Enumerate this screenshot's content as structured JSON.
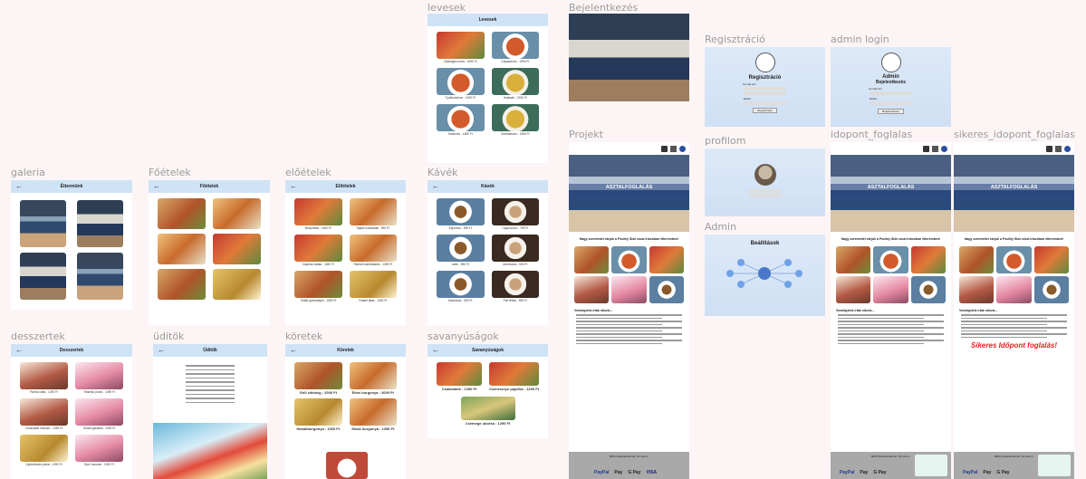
{
  "labels": {
    "levesek": "levesek",
    "bejelentkezes": "Bejelentkezés",
    "regisztracio": "Regisztráció",
    "admin_login": "admin login",
    "galeria": "galeria",
    "foetelek": "Főételek",
    "eloetelek": "előételek",
    "kavek": "Kávék",
    "projekt": "Projekt",
    "profilom": "profilom",
    "idopont_foglalas": "idopont_foglalas",
    "sikeres_idopont_foglalas": "sikeres_idopont_foglalas",
    "admin": "Admin",
    "desszertek": "desszertek",
    "uditok": "üditök",
    "koretek": "köretek",
    "savanyusagok": "savanyúságok"
  },
  "headers": {
    "levesek": "Levesek",
    "galeria": "Éttermünk",
    "foetelek": "Főételek",
    "eloetelek": "Előételek",
    "kavek": "Kávék",
    "desszertek": "Desszertek",
    "uditok": "Üdítők",
    "koretek": "Köretek",
    "savanyusagok": "Savanyúságok"
  },
  "levesek_items": [
    "Zöldséges leves - 1690 Ft",
    "Gulyásleves - 1990 Ft",
    "Tyúkhúsleves - 1490 Ft",
    "Halászlé - 2190 Ft",
    "Húsleves - 1690 Ft",
    "Gombaleves - 1490 Ft"
  ],
  "eloetelek_items": [
    "Bruschetta - 1490 Ft",
    "Sajtos rudacskák - 990 Ft",
    "Caprese saláta - 1690 Ft",
    "Rántott csirkefalatok - 1490 Ft",
    "Töltött gombafejek - 1590 Ft",
    "Falafel tálak - 1390 Ft"
  ],
  "kavek_items": [
    "Espresso - 590 Ft",
    "Cappuccino - 790 Ft",
    "Latte - 890 Ft",
    "Americano - 690 Ft",
    "Macchiato - 690 Ft",
    "Flat White - 890 Ft"
  ],
  "desszertek_items": [
    "Panna cotta - 1290 Ft",
    "Tiramisu pohár - 1490 Ft",
    "Csokoládé mousse - 1290 Ft",
    "Somlói galuska - 1490 Ft",
    "Gyümölcsös pohár - 1390 Ft",
    "Eper mousse - 1390 Ft"
  ],
  "koretek_items": [
    "Grill zöldség : 2000 Ft",
    "Édes burgonya : 2000 Ft",
    "Hasábburgonya : 1300 Ft",
    "Steak burgonya : 1390 Ft"
  ],
  "savanyusagok_items": [
    "Csalamádé : 1290 Ft",
    "Cseresznye paprika : 1290 Ft",
    "Csemege uborka : 1290 Ft"
  ],
  "login": {
    "reg_title": "Regisztráció",
    "admin_title": "Admin",
    "admin_sub": "Bejelentkezés",
    "email_label": "E-mail cím",
    "pass_label": "Jelszó",
    "submit": "Regisztráció",
    "login_btn": "Bejelentkezés"
  },
  "admin_title": "Beállítások",
  "home": {
    "hero_title": "ASZTALFOGLALÁS",
    "welcome": "Nagy szeretettel várjuk a Poultry Side utcai Irtozóban étteremben!",
    "reviews_title": "Vendégeink írták rólunk...",
    "success": "Sikeres Időpont foglalás!"
  },
  "footer": {
    "address": "8000 Székesfehérvár, Fő utca 1.",
    "pay1": "PayPal",
    "pay2": "Pay",
    "pay3": "G Pay",
    "pay4": "VISA"
  },
  "colors": {
    "accent": "#cfe3f7",
    "footer": "#a9a9a9",
    "success": "#e32020"
  }
}
